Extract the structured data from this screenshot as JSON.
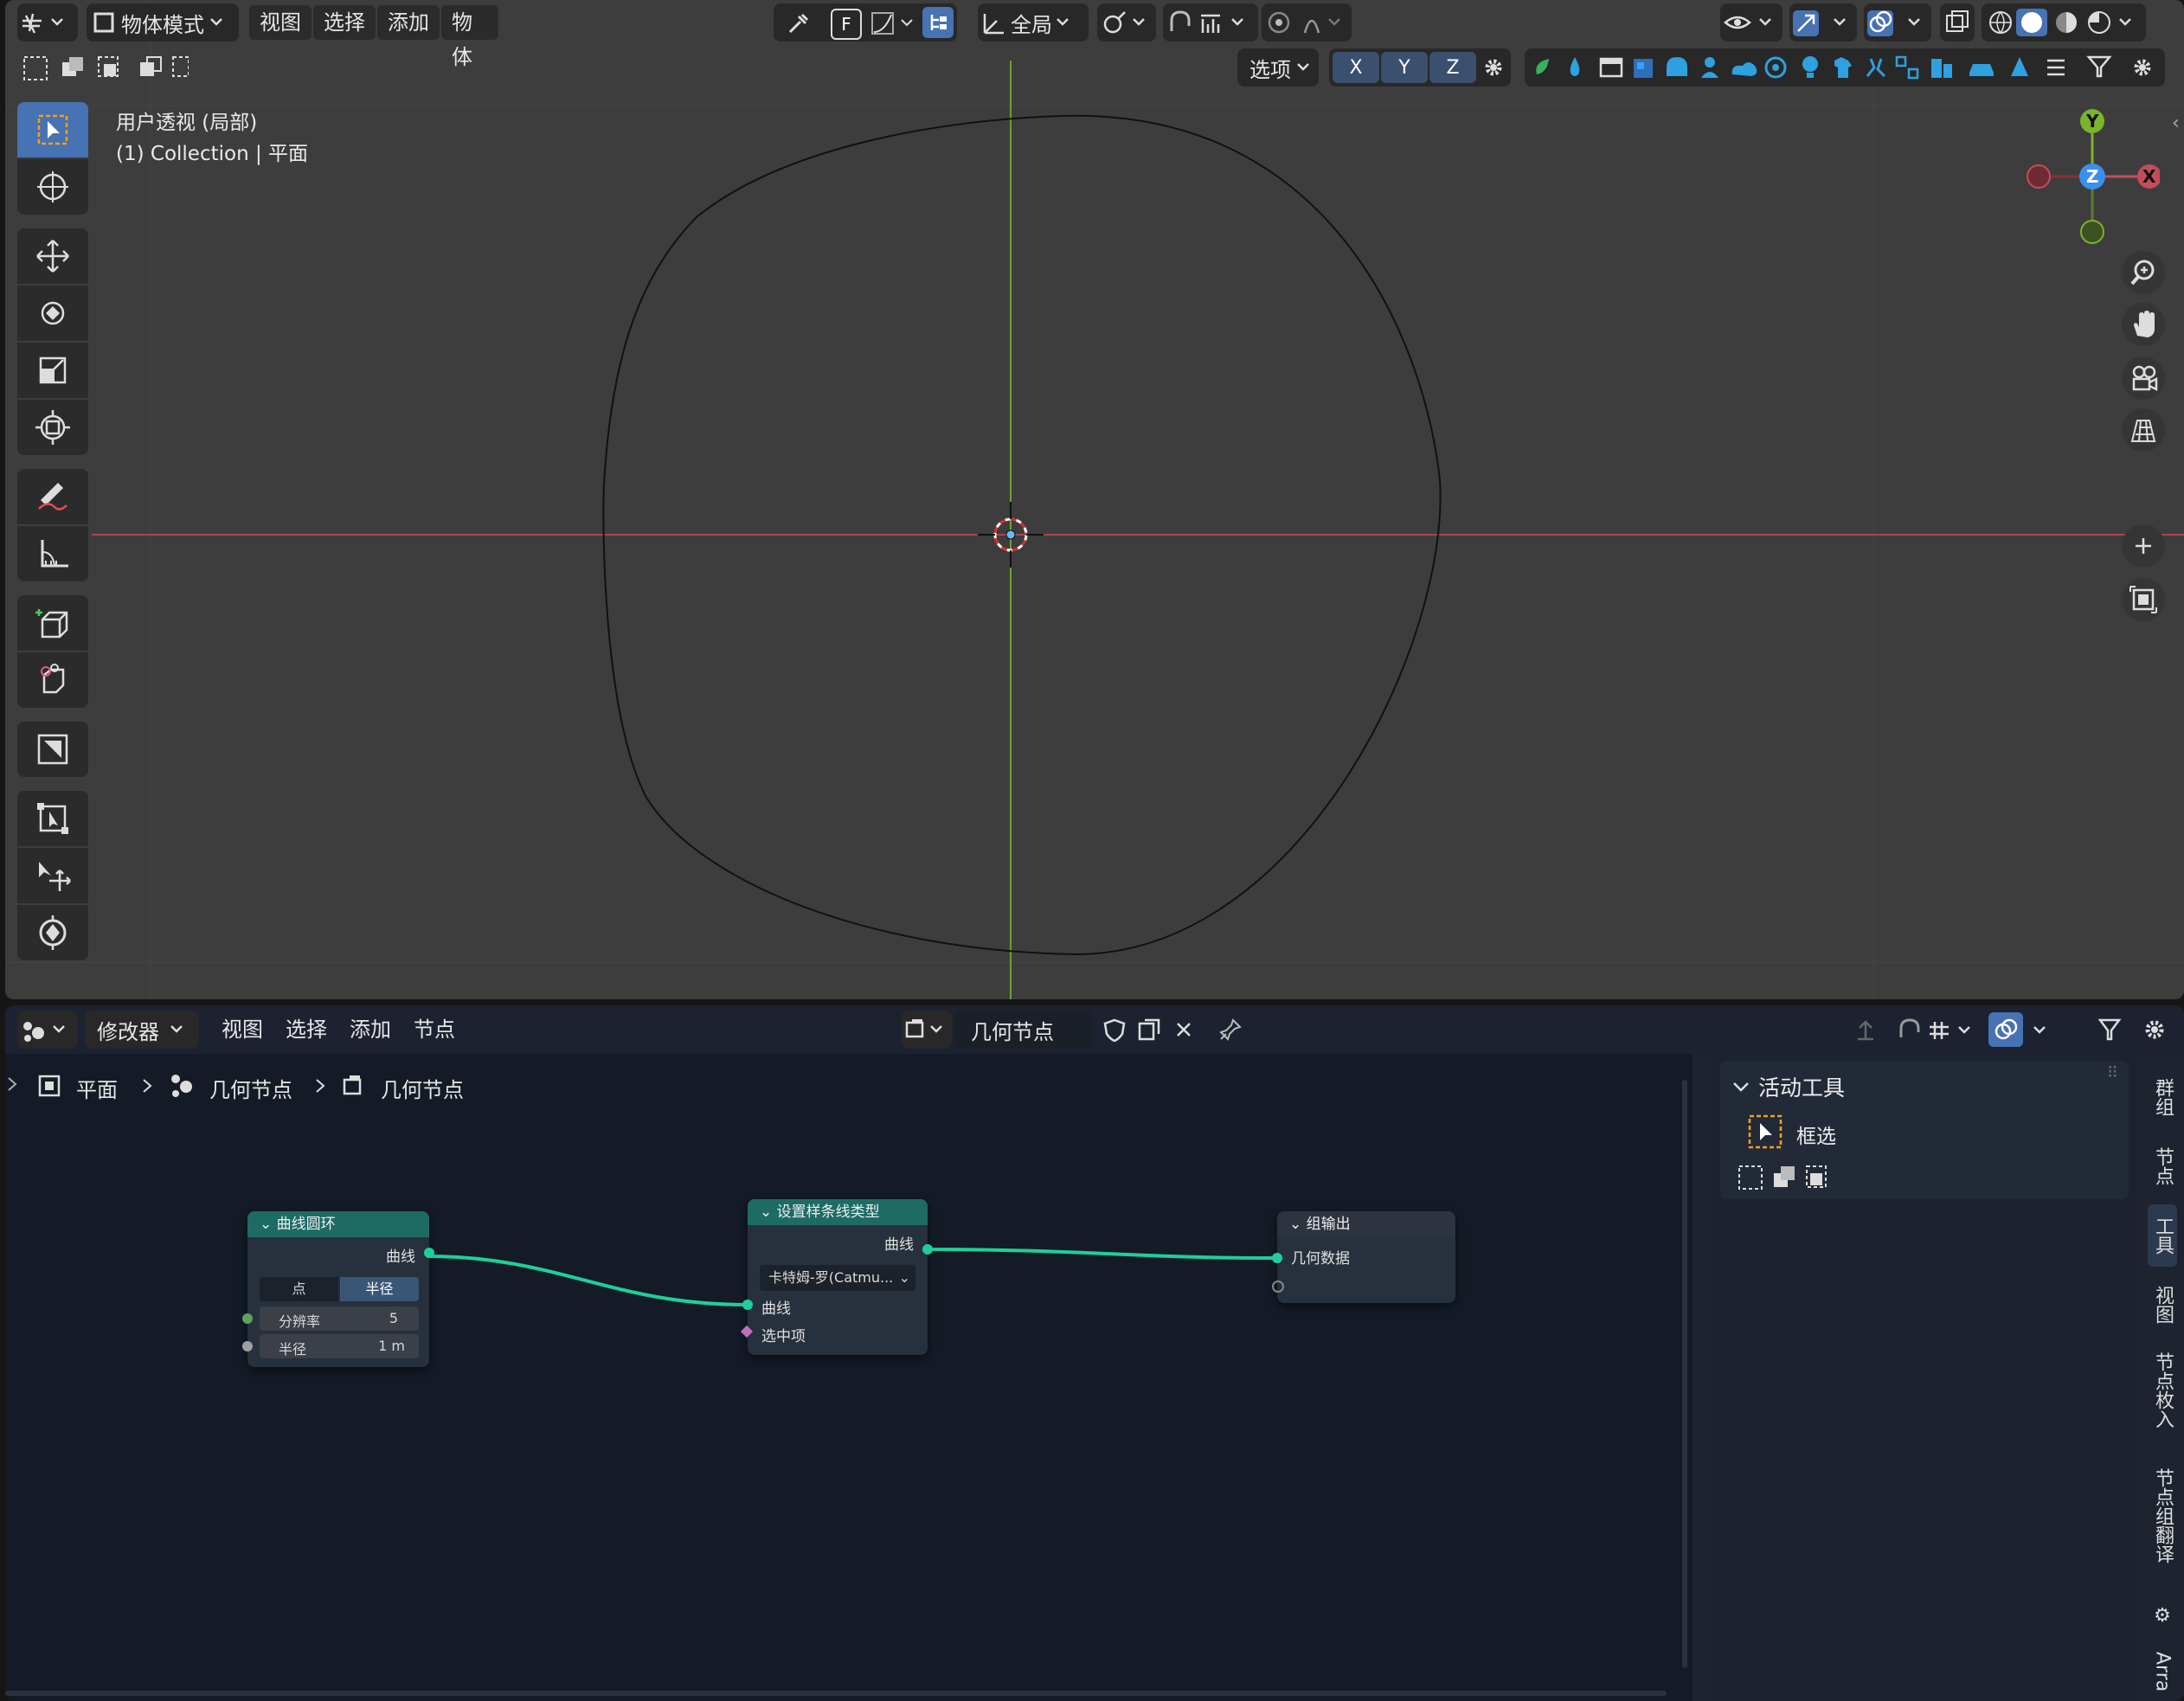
{
  "viewport": {
    "header": {
      "mode_label": "物体模式",
      "menu": [
        "视图",
        "选择",
        "添加",
        "物体"
      ],
      "transform_orientation": "全局",
      "options_label": "选项",
      "axis_buttons": [
        "X",
        "Y",
        "Z"
      ]
    },
    "overlay": {
      "view_name": "用户透视 (局部)",
      "collection_info": "(1) Collection | 平面"
    },
    "gizmo": {
      "x": "X",
      "y": "Y",
      "z": "Z"
    },
    "colors": {
      "x_axis": "#c44d5a",
      "y_axis": "#7ab32d",
      "z_axis": "#3c8ef0"
    }
  },
  "node_editor": {
    "header": {
      "editor_type_label": "修改器",
      "menu": [
        "视图",
        "选择",
        "添加",
        "节点"
      ],
      "node_tree_name": "几何节点"
    },
    "breadcrumb": [
      "平面",
      "几何节点",
      "几何节点"
    ],
    "nodes": {
      "curve_circle": {
        "title": "曲线圆环",
        "output_label": "曲线",
        "mode_options": [
          "点",
          "半径"
        ],
        "resolution_label": "分辨率",
        "resolution_value": "5",
        "radius_label": "半径",
        "radius_value": "1 m"
      },
      "set_spline_type": {
        "title": "设置样条线类型",
        "output_label": "曲线",
        "type_value": "卡特姆-罗(Catmu...",
        "input_curve_label": "曲线",
        "input_selection_label": "选中项"
      },
      "group_output": {
        "title": "组输出",
        "input_label": "几何数据"
      }
    },
    "side_panel": {
      "section_title": "活动工具",
      "tool_name": "框选",
      "tabs": [
        "群组",
        "节点",
        "工具",
        "视图",
        "节点枚入",
        "节点组翻译",
        "⚙",
        "Arra"
      ]
    },
    "colors": {
      "curve_circle_header": "#1e6b66",
      "spline_header": "#1e6b66",
      "output_header": "#2d3440",
      "geometry_socket": "#1fcf9a",
      "link": "#1fcf9a"
    }
  }
}
